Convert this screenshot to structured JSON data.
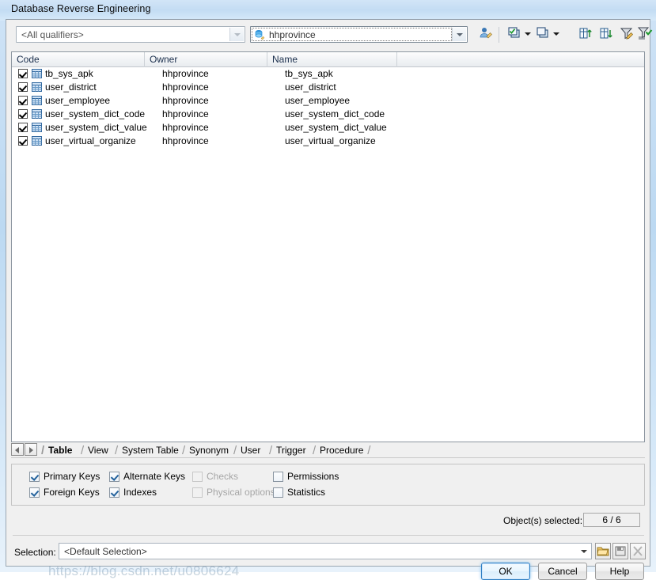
{
  "window": {
    "title": "Database Reverse Engineering"
  },
  "toolbar": {
    "qualifier_value": "<All qualifiers>",
    "owner_value": "hhprovince",
    "icons": [
      {
        "name": "user-filter-icon",
        "tooltip": "User"
      },
      {
        "name": "select-all-icon",
        "tooltip": "Select All"
      },
      {
        "name": "select-all-dropdown-icon",
        "tooltip": "Select All Options"
      },
      {
        "name": "deselect-all-icon",
        "tooltip": "Deselect All"
      },
      {
        "name": "deselect-all-dropdown-icon",
        "tooltip": "Deselect All Options"
      },
      {
        "name": "sort-ascending-icon",
        "tooltip": "Sort Ascending"
      },
      {
        "name": "sort-descending-icon",
        "tooltip": "Sort Descending"
      },
      {
        "name": "edit-filter-icon",
        "tooltip": "Edit Filter"
      },
      {
        "name": "apply-filter-icon",
        "tooltip": "Apply Filter"
      }
    ]
  },
  "list": {
    "columns": [
      "Code",
      "Owner",
      "Name",
      ""
    ],
    "rows": [
      {
        "checked": true,
        "code": "tb_sys_apk",
        "owner": "hhprovince",
        "name": "tb_sys_apk"
      },
      {
        "checked": true,
        "code": "user_district",
        "owner": "hhprovince",
        "name": "user_district"
      },
      {
        "checked": true,
        "code": "user_employee",
        "owner": "hhprovince",
        "name": "user_employee"
      },
      {
        "checked": true,
        "code": "user_system_dict_code",
        "owner": "hhprovince",
        "name": "user_system_dict_code"
      },
      {
        "checked": true,
        "code": "user_system_dict_value",
        "owner": "hhprovince",
        "name": "user_system_dict_value"
      },
      {
        "checked": true,
        "code": "user_virtual_organize",
        "owner": "hhprovince",
        "name": "user_virtual_organize"
      }
    ]
  },
  "tabs": {
    "items": [
      "Table",
      "View",
      "System Table",
      "Synonym",
      "User",
      "Trigger",
      "Procedure"
    ],
    "active": "Table"
  },
  "options": [
    {
      "label": "Primary Keys",
      "checked": true,
      "enabled": true
    },
    {
      "label": "Alternate Keys",
      "checked": true,
      "enabled": true
    },
    {
      "label": "Checks",
      "checked": false,
      "enabled": false
    },
    {
      "label": "Permissions",
      "checked": false,
      "enabled": true
    },
    {
      "label": "Foreign Keys",
      "checked": true,
      "enabled": true
    },
    {
      "label": "Indexes",
      "checked": true,
      "enabled": true
    },
    {
      "label": "Physical options",
      "checked": false,
      "enabled": false
    },
    {
      "label": "Statistics",
      "checked": false,
      "enabled": true
    }
  ],
  "status": {
    "objects_selected_label": "Object(s) selected:",
    "objects_selected_value": "6 / 6"
  },
  "selection": {
    "label": "Selection:",
    "value": "<Default Selection>",
    "buttons": [
      {
        "name": "open-selection-icon"
      },
      {
        "name": "save-selection-icon"
      },
      {
        "name": "delete-selection-icon"
      }
    ]
  },
  "buttons": {
    "ok": "OK",
    "cancel": "Cancel",
    "help": "Help"
  },
  "watermark": {
    "text": "https://blog.csdn.net/u0806624"
  },
  "colors": {
    "accent": "#2f7fc4",
    "titlebar": "#c3dcf3",
    "dialog_face": "#f0f0f0"
  }
}
